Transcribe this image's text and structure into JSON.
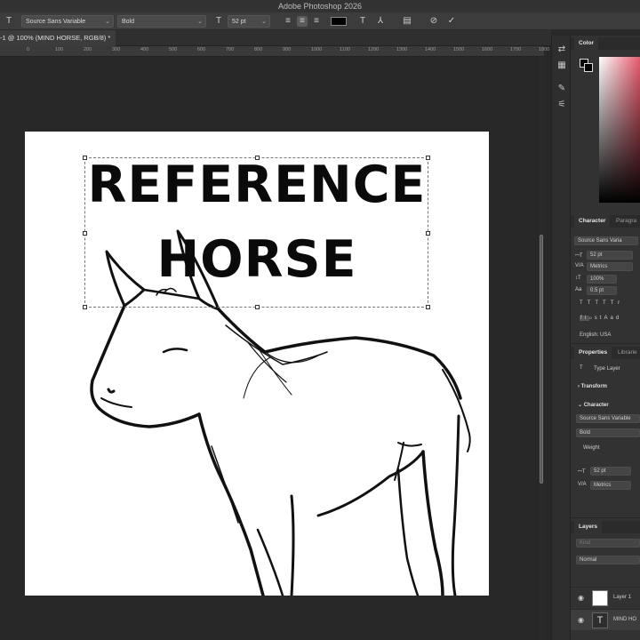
{
  "app": {
    "title": "Adobe Photoshop 2026"
  },
  "options_bar": {
    "font_family": "Source Sans Variable",
    "font_style": "Bold",
    "font_size": "52 pt",
    "color_swatch": "#000000"
  },
  "document": {
    "tab_label": "-1 @ 100% (MIND HORSE, RGB/8) *",
    "ruler_ticks": [
      "0",
      "100",
      "200",
      "300",
      "400",
      "500",
      "600",
      "700",
      "800",
      "900",
      "1000",
      "1100",
      "1200",
      "1300",
      "1400",
      "1500",
      "1600",
      "1700",
      "1800"
    ],
    "canvas_text_line1": "REFERENCE",
    "canvas_text_line2": "HORSE"
  },
  "panels": {
    "color": {
      "tab": "Color",
      "foreground": "#000000",
      "background": "#000000"
    },
    "character": {
      "tab_active": "Character",
      "tab_other": "Paragra",
      "font_family": "Source Sans Varia",
      "font_size": "52 pt",
      "kerning": "Metrics",
      "vertical_scale": "100%",
      "baseline_shift": "0.5 pt",
      "language": "English: USA",
      "style_buttons": [
        "T",
        "T",
        "TT",
        "Tr"
      ],
      "opentype_buttons": [
        "fi",
        "ℴ",
        "st",
        "A",
        "ad",
        "T",
        "1st",
        "½"
      ]
    },
    "properties": {
      "tab_active": "Properties",
      "tab_other": "Librarie",
      "layer_type": "Type Layer",
      "transform": "Transform",
      "character": "Character",
      "font_family": "Source Sans Variable",
      "font_style": "Bold",
      "weight_label": "Weight",
      "font_size": "52 pt",
      "kerning": "Metrics"
    },
    "layers": {
      "tab": "Layers",
      "search_placeholder": "Kind",
      "blend_mode": "Normal",
      "items": [
        {
          "name": "Layer 1",
          "type": "pixel"
        },
        {
          "name": "MIND HO",
          "type": "text"
        }
      ]
    }
  }
}
